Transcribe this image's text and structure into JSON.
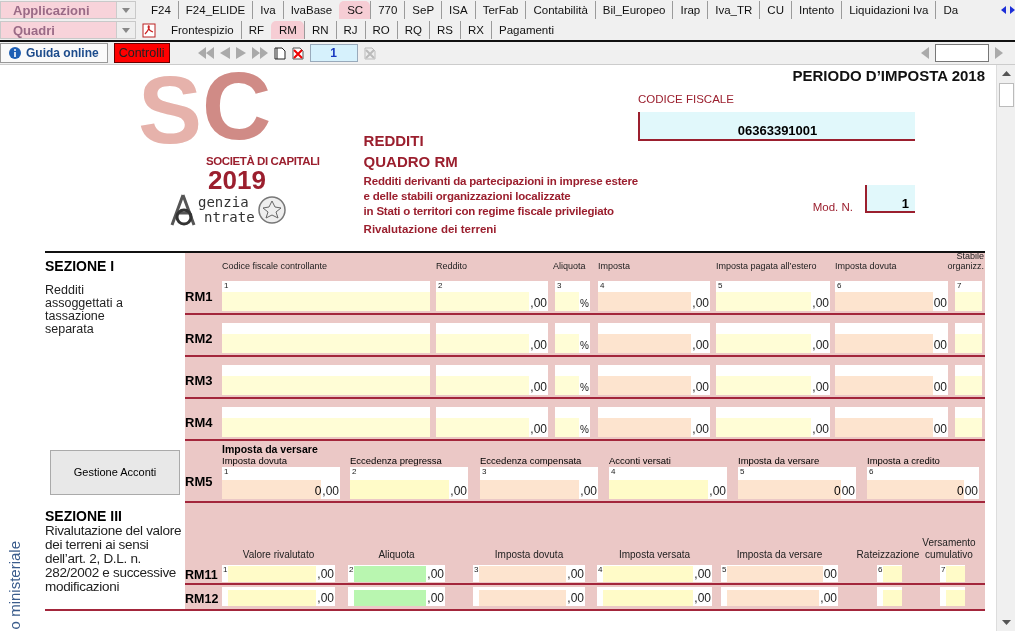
{
  "app_menu": {
    "label": "Applicazioni"
  },
  "quadri_menu": {
    "label": "Quadri"
  },
  "top_tabs": [
    {
      "label": "F24",
      "selected": false
    },
    {
      "label": "F24_ELIDE",
      "selected": false
    },
    {
      "label": "Iva",
      "selected": false
    },
    {
      "label": "IvaBase",
      "selected": false
    },
    {
      "label": "SC",
      "selected": true
    },
    {
      "label": "770",
      "selected": false
    },
    {
      "label": "SeP",
      "selected": false
    },
    {
      "label": "ISA",
      "selected": false
    },
    {
      "label": "TerFab",
      "selected": false
    },
    {
      "label": "Contabilità",
      "selected": false
    },
    {
      "label": "Bil_Europeo",
      "selected": false
    },
    {
      "label": "Irap",
      "selected": false
    },
    {
      "label": "Iva_TR",
      "selected": false
    },
    {
      "label": "CU",
      "selected": false
    },
    {
      "label": "Intento",
      "selected": false
    },
    {
      "label": "Liquidazioni Iva",
      "selected": false
    },
    {
      "label": "Da",
      "selected": false
    }
  ],
  "quadri_tabs": [
    {
      "label": "Frontespizio",
      "selected": false
    },
    {
      "label": "RF",
      "selected": false
    },
    {
      "label": "RM",
      "selected": true
    },
    {
      "label": "RN",
      "selected": false
    },
    {
      "label": "RJ",
      "selected": false
    },
    {
      "label": "RO",
      "selected": false
    },
    {
      "label": "RQ",
      "selected": false
    },
    {
      "label": "RS",
      "selected": false
    },
    {
      "label": "RX",
      "selected": false
    },
    {
      "label": "Pagamenti",
      "selected": false
    }
  ],
  "toolbar": {
    "help": "Guida online",
    "checks": "Controlli",
    "page": "1"
  },
  "form": {
    "period": "PERIODO D’IMPOSTA 2018",
    "logo": {
      "letters": [
        "S",
        "C"
      ],
      "name": "SOCIETÀ DI CAPITALI",
      "year": "2019",
      "agency": [
        "genzia",
        "ntrate"
      ]
    },
    "titles": [
      "REDDITI",
      "QUADRO RM"
    ],
    "description": [
      "Redditi derivanti da partecipazioni in imprese estere",
      "e delle stabili organizzazioni localizzate",
      "in Stati o territori con regime fiscale privilegiato"
    ],
    "subtitle": "Rivalutazione dei terreni",
    "tax_code": {
      "label": "CODICE FISCALE",
      "value": "06363391001"
    },
    "model_no": {
      "label": "Mod. N.",
      "value": "1"
    },
    "side_label": "o ministeriale"
  },
  "section_1": {
    "title": "SEZIONE I",
    "description": "Redditi assoggettati a tassazione separata",
    "columns": [
      {
        "label": "Codice fiscale controllante",
        "num": "1",
        "color": "#fffdd6"
      },
      {
        "label": "Reddito",
        "num": "2",
        "color": "#fffdd6"
      },
      {
        "label": "Aliquota",
        "num": "3",
        "color": "#fffdd6"
      },
      {
        "label": "Imposta",
        "num": "4",
        "color": "#fde4cf"
      },
      {
        "label": "Imposta pagata all’estero",
        "num": "5",
        "color": "#fffdd6"
      },
      {
        "label": "Imposta dovuta",
        "num": "6",
        "color": "#fde4cf"
      },
      {
        "label": "Stabile organizz.",
        "num": "7",
        "color": "#fffdd6"
      }
    ],
    "rows": [
      {
        "code": "RM1",
        "cells": [
          {
            "kind": "text"
          },
          {
            "kind": "amount",
            "suffix": ",00"
          },
          {
            "kind": "rate",
            "suffix": "%"
          },
          {
            "kind": "amount",
            "suffix": ",00"
          },
          {
            "kind": "amount",
            "suffix": ",00"
          },
          {
            "kind": "amount",
            "suffix": "00"
          },
          {
            "kind": "flag"
          }
        ]
      },
      {
        "code": "RM2",
        "cells": [
          {
            "kind": "text"
          },
          {
            "kind": "amount",
            "suffix": ",00"
          },
          {
            "kind": "rate",
            "suffix": "%"
          },
          {
            "kind": "amount",
            "suffix": ",00"
          },
          {
            "kind": "amount",
            "suffix": ",00"
          },
          {
            "kind": "amount",
            "suffix": "00"
          },
          {
            "kind": "flag"
          }
        ]
      },
      {
        "code": "RM3",
        "cells": [
          {
            "kind": "text"
          },
          {
            "kind": "amount",
            "suffix": ",00"
          },
          {
            "kind": "rate",
            "suffix": "%"
          },
          {
            "kind": "amount",
            "suffix": ",00"
          },
          {
            "kind": "amount",
            "suffix": ",00"
          },
          {
            "kind": "amount",
            "suffix": "00"
          },
          {
            "kind": "flag"
          }
        ]
      },
      {
        "code": "RM4",
        "cells": [
          {
            "kind": "text"
          },
          {
            "kind": "amount",
            "suffix": ",00"
          },
          {
            "kind": "rate",
            "suffix": "%"
          },
          {
            "kind": "amount",
            "suffix": ",00"
          },
          {
            "kind": "amount",
            "suffix": ",00"
          },
          {
            "kind": "amount",
            "suffix": "00"
          },
          {
            "kind": "flag"
          }
        ]
      }
    ]
  },
  "rm5": {
    "code": "RM5",
    "heading": "Imposta da versare",
    "button": "Gestione Acconti",
    "cells": [
      {
        "num": "1",
        "label": "Imposta dovuta",
        "value": "0",
        "suffix": ",00",
        "color": "#fde4cf"
      },
      {
        "num": "2",
        "label": "Eccedenza pregressa",
        "suffix": ",00",
        "color": "#fffbc8"
      },
      {
        "num": "3",
        "label": "Eccedenza compensata",
        "suffix": ",00",
        "color": "#fde4cf"
      },
      {
        "num": "4",
        "label": "Acconti versati",
        "suffix": ",00",
        "color": "#fffbc8"
      },
      {
        "num": "5",
        "label": "Imposta da versare",
        "value": "0",
        "suffix": "00",
        "color": "#fde4cf"
      },
      {
        "num": "6",
        "label": "Imposta a credito",
        "value": "0",
        "suffix": "00",
        "color": "#fde4cf"
      }
    ]
  },
  "section_3": {
    "title": "SEZIONE III",
    "description": "Rivalutazione del valore dei terreni ai sensi dell’art. 2, D.L. n. 282/2002 e successive modificazioni",
    "columns": [
      {
        "label": "Valore rivalutato",
        "num": "1",
        "color": "#fffbc8"
      },
      {
        "label": "Aliquota",
        "num": "2",
        "color": "#b9f6b0"
      },
      {
        "label": "Imposta dovuta",
        "num": "3",
        "color": "#fde4cf"
      },
      {
        "label": "Imposta versata",
        "num": "4",
        "color": "#fffbc8"
      },
      {
        "label": "Imposta da versare",
        "num": "5",
        "color": "#fde4cf"
      },
      {
        "label": "Rateizzazione",
        "num": "6",
        "color": "#fffbc8"
      },
      {
        "label": "Versamento cumulativo",
        "num": "7",
        "color": "#fffbc8"
      }
    ],
    "rows": [
      {
        "code": "RM11",
        "cells": [
          {
            "kind": "amount",
            "suffix": ",00"
          },
          {
            "kind": "amount",
            "suffix": ",00"
          },
          {
            "kind": "amount",
            "suffix": ",00"
          },
          {
            "kind": "amount",
            "suffix": ",00"
          },
          {
            "kind": "amount",
            "suffix": "00"
          },
          {
            "kind": "flag"
          },
          {
            "kind": "flag"
          }
        ]
      },
      {
        "code": "RM12",
        "cells": [
          {
            "kind": "amount",
            "suffix": ",00"
          },
          {
            "kind": "amount",
            "suffix": ",00"
          },
          {
            "kind": "amount",
            "suffix": ",00"
          },
          {
            "kind": "amount",
            "suffix": ",00"
          },
          {
            "kind": "amount",
            "suffix": ",00"
          },
          {
            "kind": "flag"
          },
          {
            "kind": "flag"
          }
        ]
      }
    ]
  }
}
